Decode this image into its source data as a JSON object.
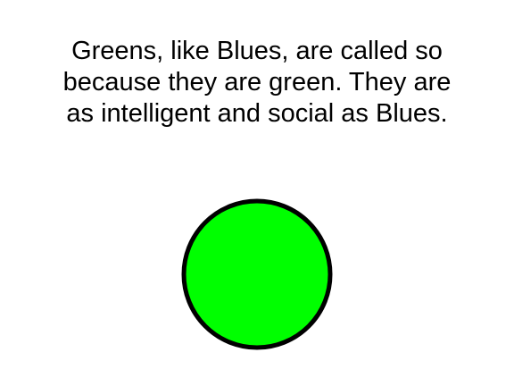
{
  "caption": {
    "lines": [
      "Greens, like Blues, are called so",
      "because they are green. They are",
      "as intelligent and social as Blues."
    ]
  },
  "figure": {
    "shape": "circle",
    "fill_color": "#00ff00",
    "stroke_color": "#000000"
  }
}
